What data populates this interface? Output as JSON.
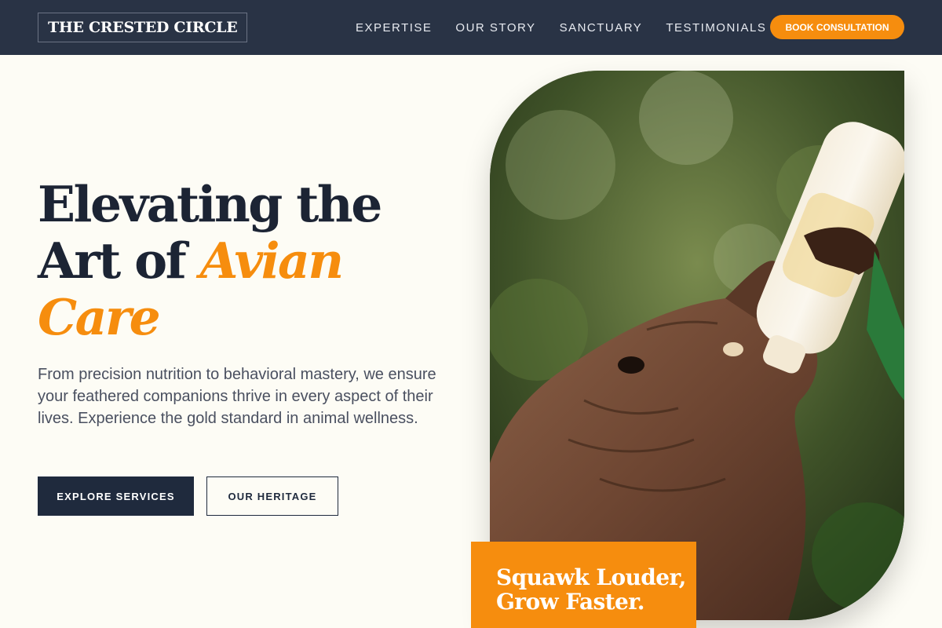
{
  "brand": {
    "name": "THE CRESTED CIRCLE"
  },
  "nav": {
    "links": [
      {
        "label": "EXPERTISE"
      },
      {
        "label": "OUR STORY"
      },
      {
        "label": "SANCTUARY"
      },
      {
        "label": "TESTIMONIALS"
      }
    ],
    "cta_label": "BOOK CONSULTATION"
  },
  "hero": {
    "title_line1": "Elevating the",
    "title_line2_plain": "Art of ",
    "title_line2_accent": "Avian",
    "title_line3_accent": "Care",
    "description": "From precision nutrition to behavioral mastery, we ensure your feathered companions thrive in every aspect of their lives. Experience the gold standard in animal wellness.",
    "primary_button": "EXPLORE SERVICES",
    "secondary_button": "OUR HERITAGE",
    "image_icon": "elephant-feeding-photo",
    "promo_line1": "Squawk Louder,",
    "promo_line2": "Grow Faster."
  },
  "colors": {
    "navbar": "#293345",
    "accent": "#f68d0e",
    "dark_text": "#1c2434",
    "page_background": "#fdfcf5"
  }
}
